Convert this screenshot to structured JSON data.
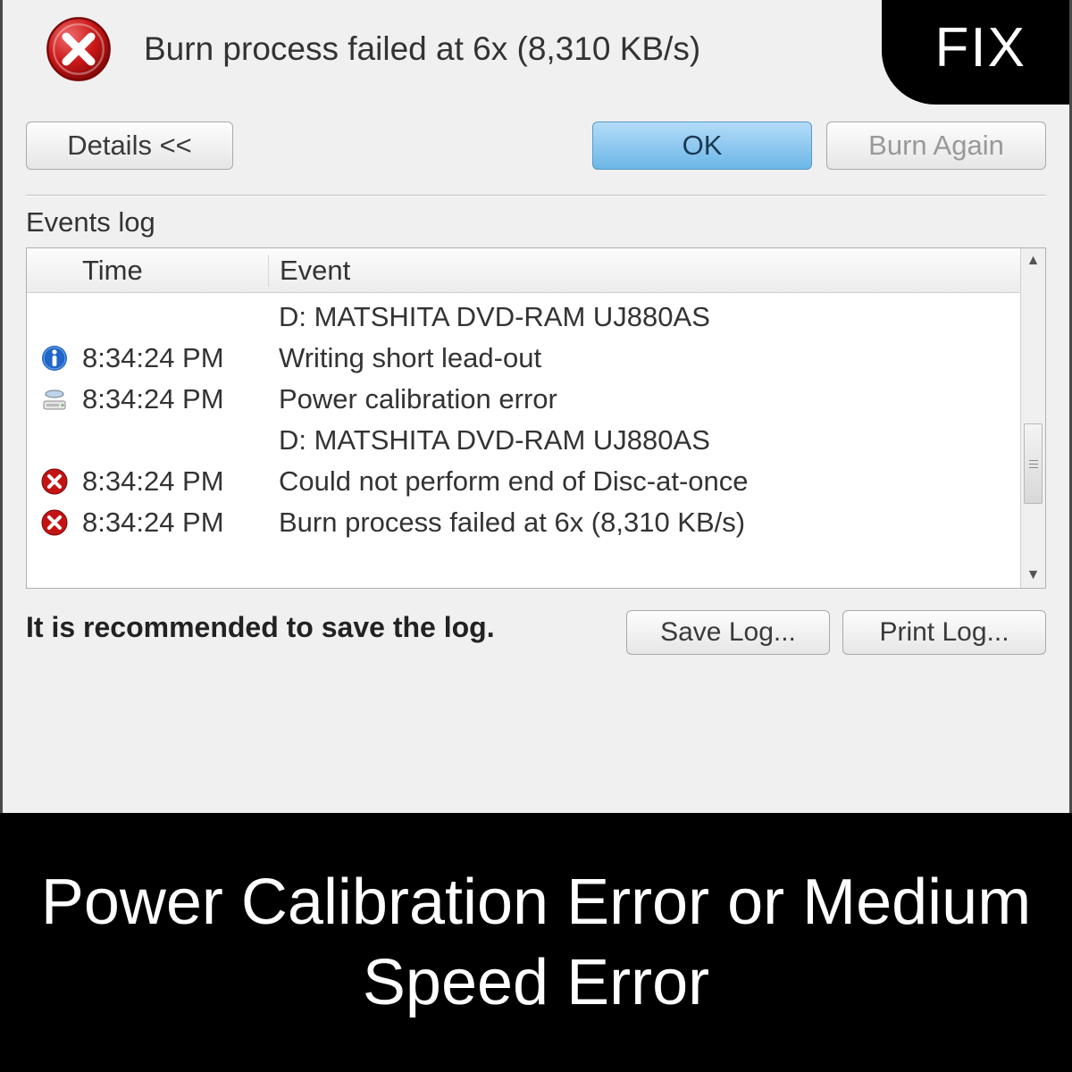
{
  "fix_badge": "FIX",
  "header": {
    "title": "Burn process failed at 6x (8,310 KB/s)"
  },
  "buttons": {
    "details": "Details <<",
    "ok": "OK",
    "burn_again": "Burn Again",
    "save_log": "Save Log...",
    "print_log": "Print Log..."
  },
  "events": {
    "section_label": "Events log",
    "columns": {
      "time": "Time",
      "event": "Event"
    },
    "rows": [
      {
        "icon": "",
        "time": "",
        "event": "D: MATSHITA DVD-RAM UJ880AS"
      },
      {
        "icon": "info",
        "time": "8:34:24 PM",
        "event": "Writing short lead-out"
      },
      {
        "icon": "drive",
        "time": "8:34:24 PM",
        "event": "Power calibration error"
      },
      {
        "icon": "",
        "time": "",
        "event": "D: MATSHITA DVD-RAM UJ880AS"
      },
      {
        "icon": "error",
        "time": "8:34:24 PM",
        "event": "Could not perform end of Disc-at-once"
      },
      {
        "icon": "error",
        "time": "8:34:24 PM",
        "event": "Burn process failed at 6x (8,310 KB/s)"
      }
    ]
  },
  "recommendation": "It is recommended to save the log.",
  "caption": "Power Calibration Error or Medium Speed Error"
}
